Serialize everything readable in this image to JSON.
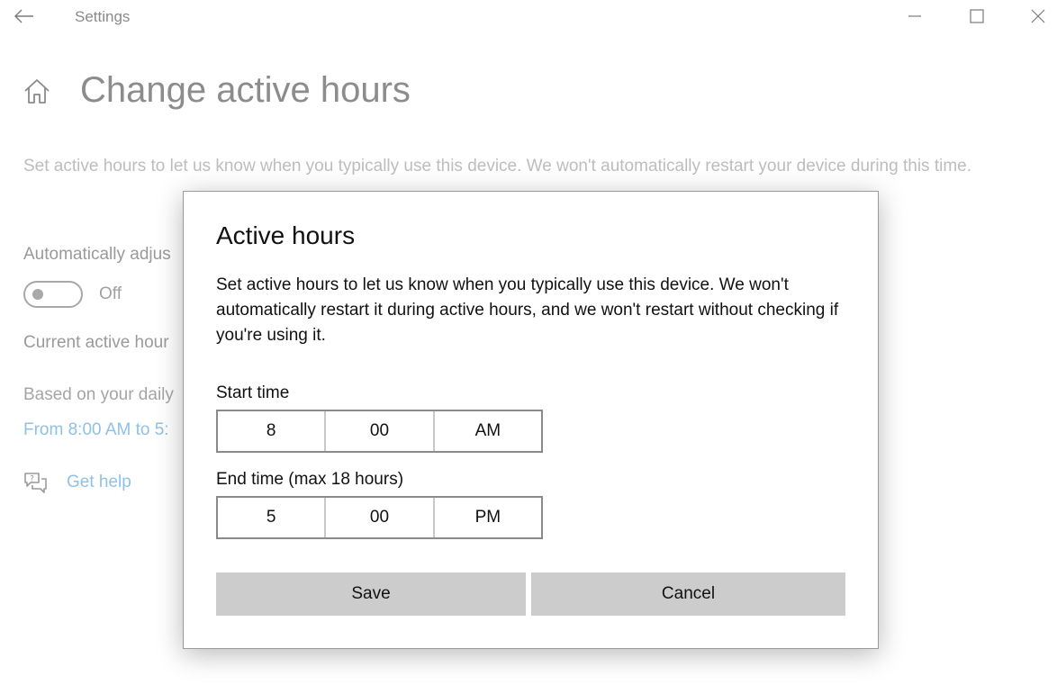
{
  "window": {
    "title": "Settings"
  },
  "page": {
    "title": "Change active hours",
    "description": "Set active hours to let us know when you typically use this device. We won't automatically restart your device during this time.",
    "auto_adjust_label": "Automatically adjus",
    "toggle_state": "Off",
    "current_label": "Current active hour",
    "based_label": "Based on your daily",
    "hours_link": "From 8:00 AM to 5:",
    "help_link": "Get help"
  },
  "dialog": {
    "title": "Active hours",
    "text": "Set active hours to let us know when you typically use this device. We won't automatically restart it during active hours, and we won't restart without checking if you're using it.",
    "start_label": "Start time",
    "start": {
      "hour": "8",
      "minute": "00",
      "period": "AM"
    },
    "end_label": "End time (max 18 hours)",
    "end": {
      "hour": "5",
      "minute": "00",
      "period": "PM"
    },
    "save_label": "Save",
    "cancel_label": "Cancel"
  },
  "icons": {
    "back": "back-arrow-icon",
    "minimize": "minimize-icon",
    "maximize": "maximize-icon",
    "close": "close-icon",
    "home": "home-icon",
    "help": "help-chat-icon"
  },
  "colors": {
    "link": "#8fc1e8",
    "button_bg": "#cccccc"
  }
}
